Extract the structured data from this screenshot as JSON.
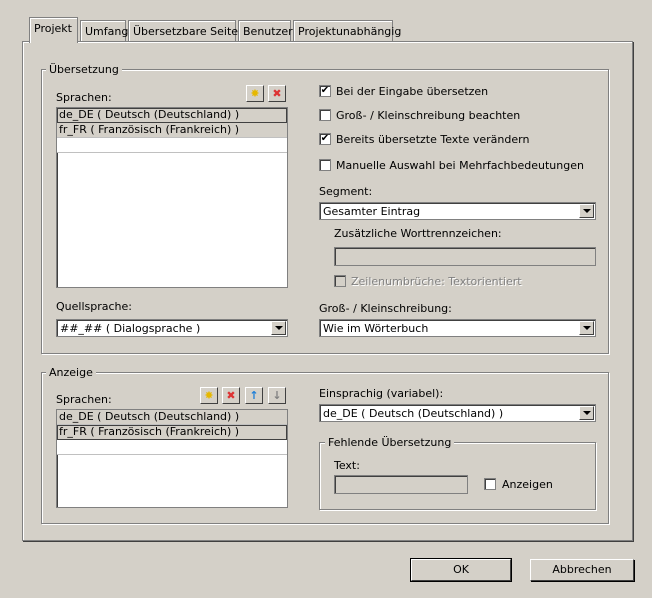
{
  "tabs": [
    {
      "label": "Projekt",
      "active": true
    },
    {
      "label": "Umfang"
    },
    {
      "label": "Übersetzbare Seiten"
    },
    {
      "label": "Benutzer"
    },
    {
      "label": "Projektunabhängig"
    }
  ],
  "translation": {
    "group_title": "Übersetzung",
    "languages_label": "Sprachen:",
    "languages": [
      "de_DE ( Deutsch (Deutschland) )",
      "fr_FR ( Französisch (Frankreich) )"
    ],
    "source_label": "Quellsprache:",
    "source_value": "##_## ( Dialogsprache )",
    "options": [
      {
        "label": "Bei der Eingabe übersetzen",
        "checked": true
      },
      {
        "label": "Groß- / Kleinschreibung beachten",
        "checked": false
      },
      {
        "label": "Bereits übersetzte Texte verändern",
        "checked": true
      },
      {
        "label": "Manuelle Auswahl bei Mehrfachbedeutungen",
        "checked": false
      }
    ],
    "segment_label": "Segment:",
    "segment_value": "Gesamter Eintrag",
    "extra_separators_label": "Zusätzliche Worttrennzeichen:",
    "line_breaks_label": "Zeilenumbrüche: Textorientiert",
    "case_label": "Groß- / Kleinschreibung:",
    "case_value": "Wie im Wörterbuch",
    "add_icon": "star-icon",
    "remove_icon": "delete-icon"
  },
  "display": {
    "group_title": "Anzeige",
    "languages_label": "Sprachen:",
    "languages": [
      "de_DE ( Deutsch (Deutschland) )",
      "fr_FR ( Französisch (Frankreich) )"
    ],
    "monolingual_label": "Einsprachig (variabel):",
    "monolingual_value": "de_DE ( Deutsch (Deutschland) )",
    "missing_group_title": "Fehlende Übersetzung",
    "text_label": "Text:",
    "show_label": "Anzeigen"
  },
  "buttons": {
    "ok": "OK",
    "cancel": "Abbrechen"
  }
}
